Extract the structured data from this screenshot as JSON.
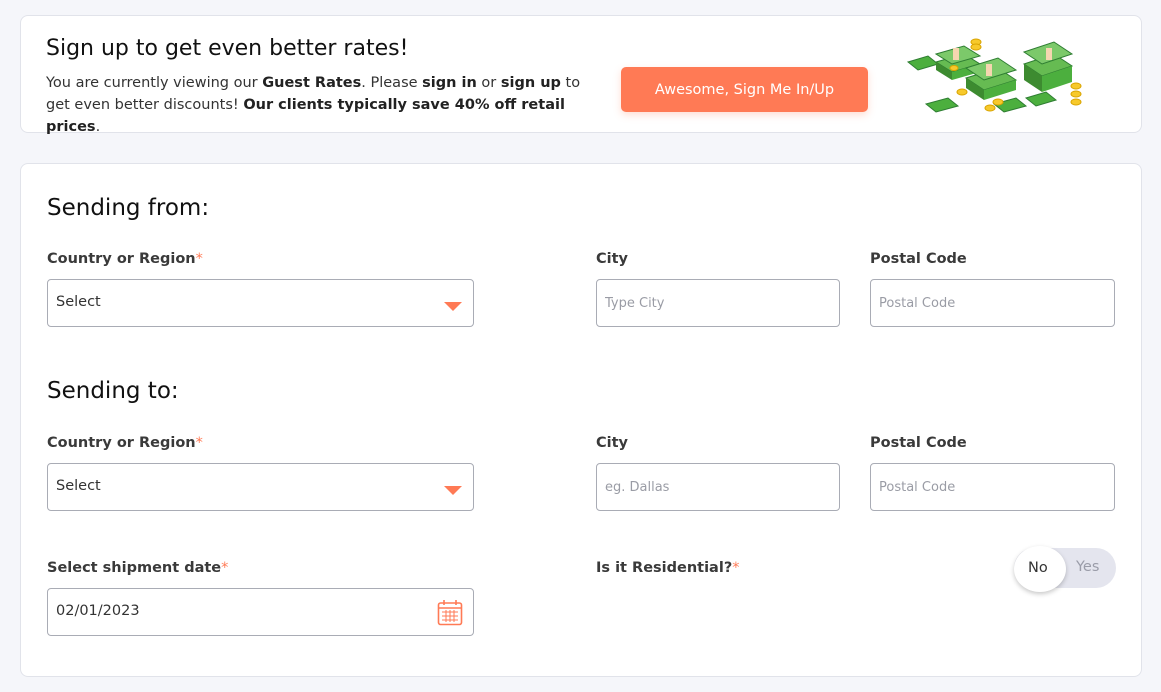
{
  "banner": {
    "title": "Sign up to get even better rates!",
    "text_1": "You are currently viewing our ",
    "guest_rates": "Guest Rates",
    "text_2": ". Please ",
    "sign_in": "sign in",
    "text_3": " or ",
    "sign_up": "sign up",
    "text_4": " to get even better discounts! ",
    "savings": "Our clients typically save 40% off retail prices",
    "text_5": ".",
    "cta_label": "Awesome, Sign Me In/Up",
    "illustration": "money-pile-illustration"
  },
  "from": {
    "title": "Sending from:",
    "country_label": "Country or Region",
    "country_value": "Select",
    "city_label": "City",
    "city_placeholder": "Type City",
    "postal_label": "Postal Code",
    "postal_placeholder": "Postal Code"
  },
  "to": {
    "title": "Sending to:",
    "country_label": "Country or Region",
    "country_value": "Select",
    "city_label": "City",
    "city_placeholder": "eg. Dallas",
    "postal_label": "Postal Code",
    "postal_placeholder": "Postal Code"
  },
  "shipment": {
    "date_label": "Select shipment date",
    "date_value": "02/01/2023",
    "residential_label": "Is it Residential?",
    "toggle_no": "No",
    "toggle_yes": "Yes",
    "residential_selected": "No"
  },
  "required_marker": "*",
  "colors": {
    "accent": "#ff7a55",
    "background": "#f5f6fa",
    "border": "#a9acb5"
  }
}
